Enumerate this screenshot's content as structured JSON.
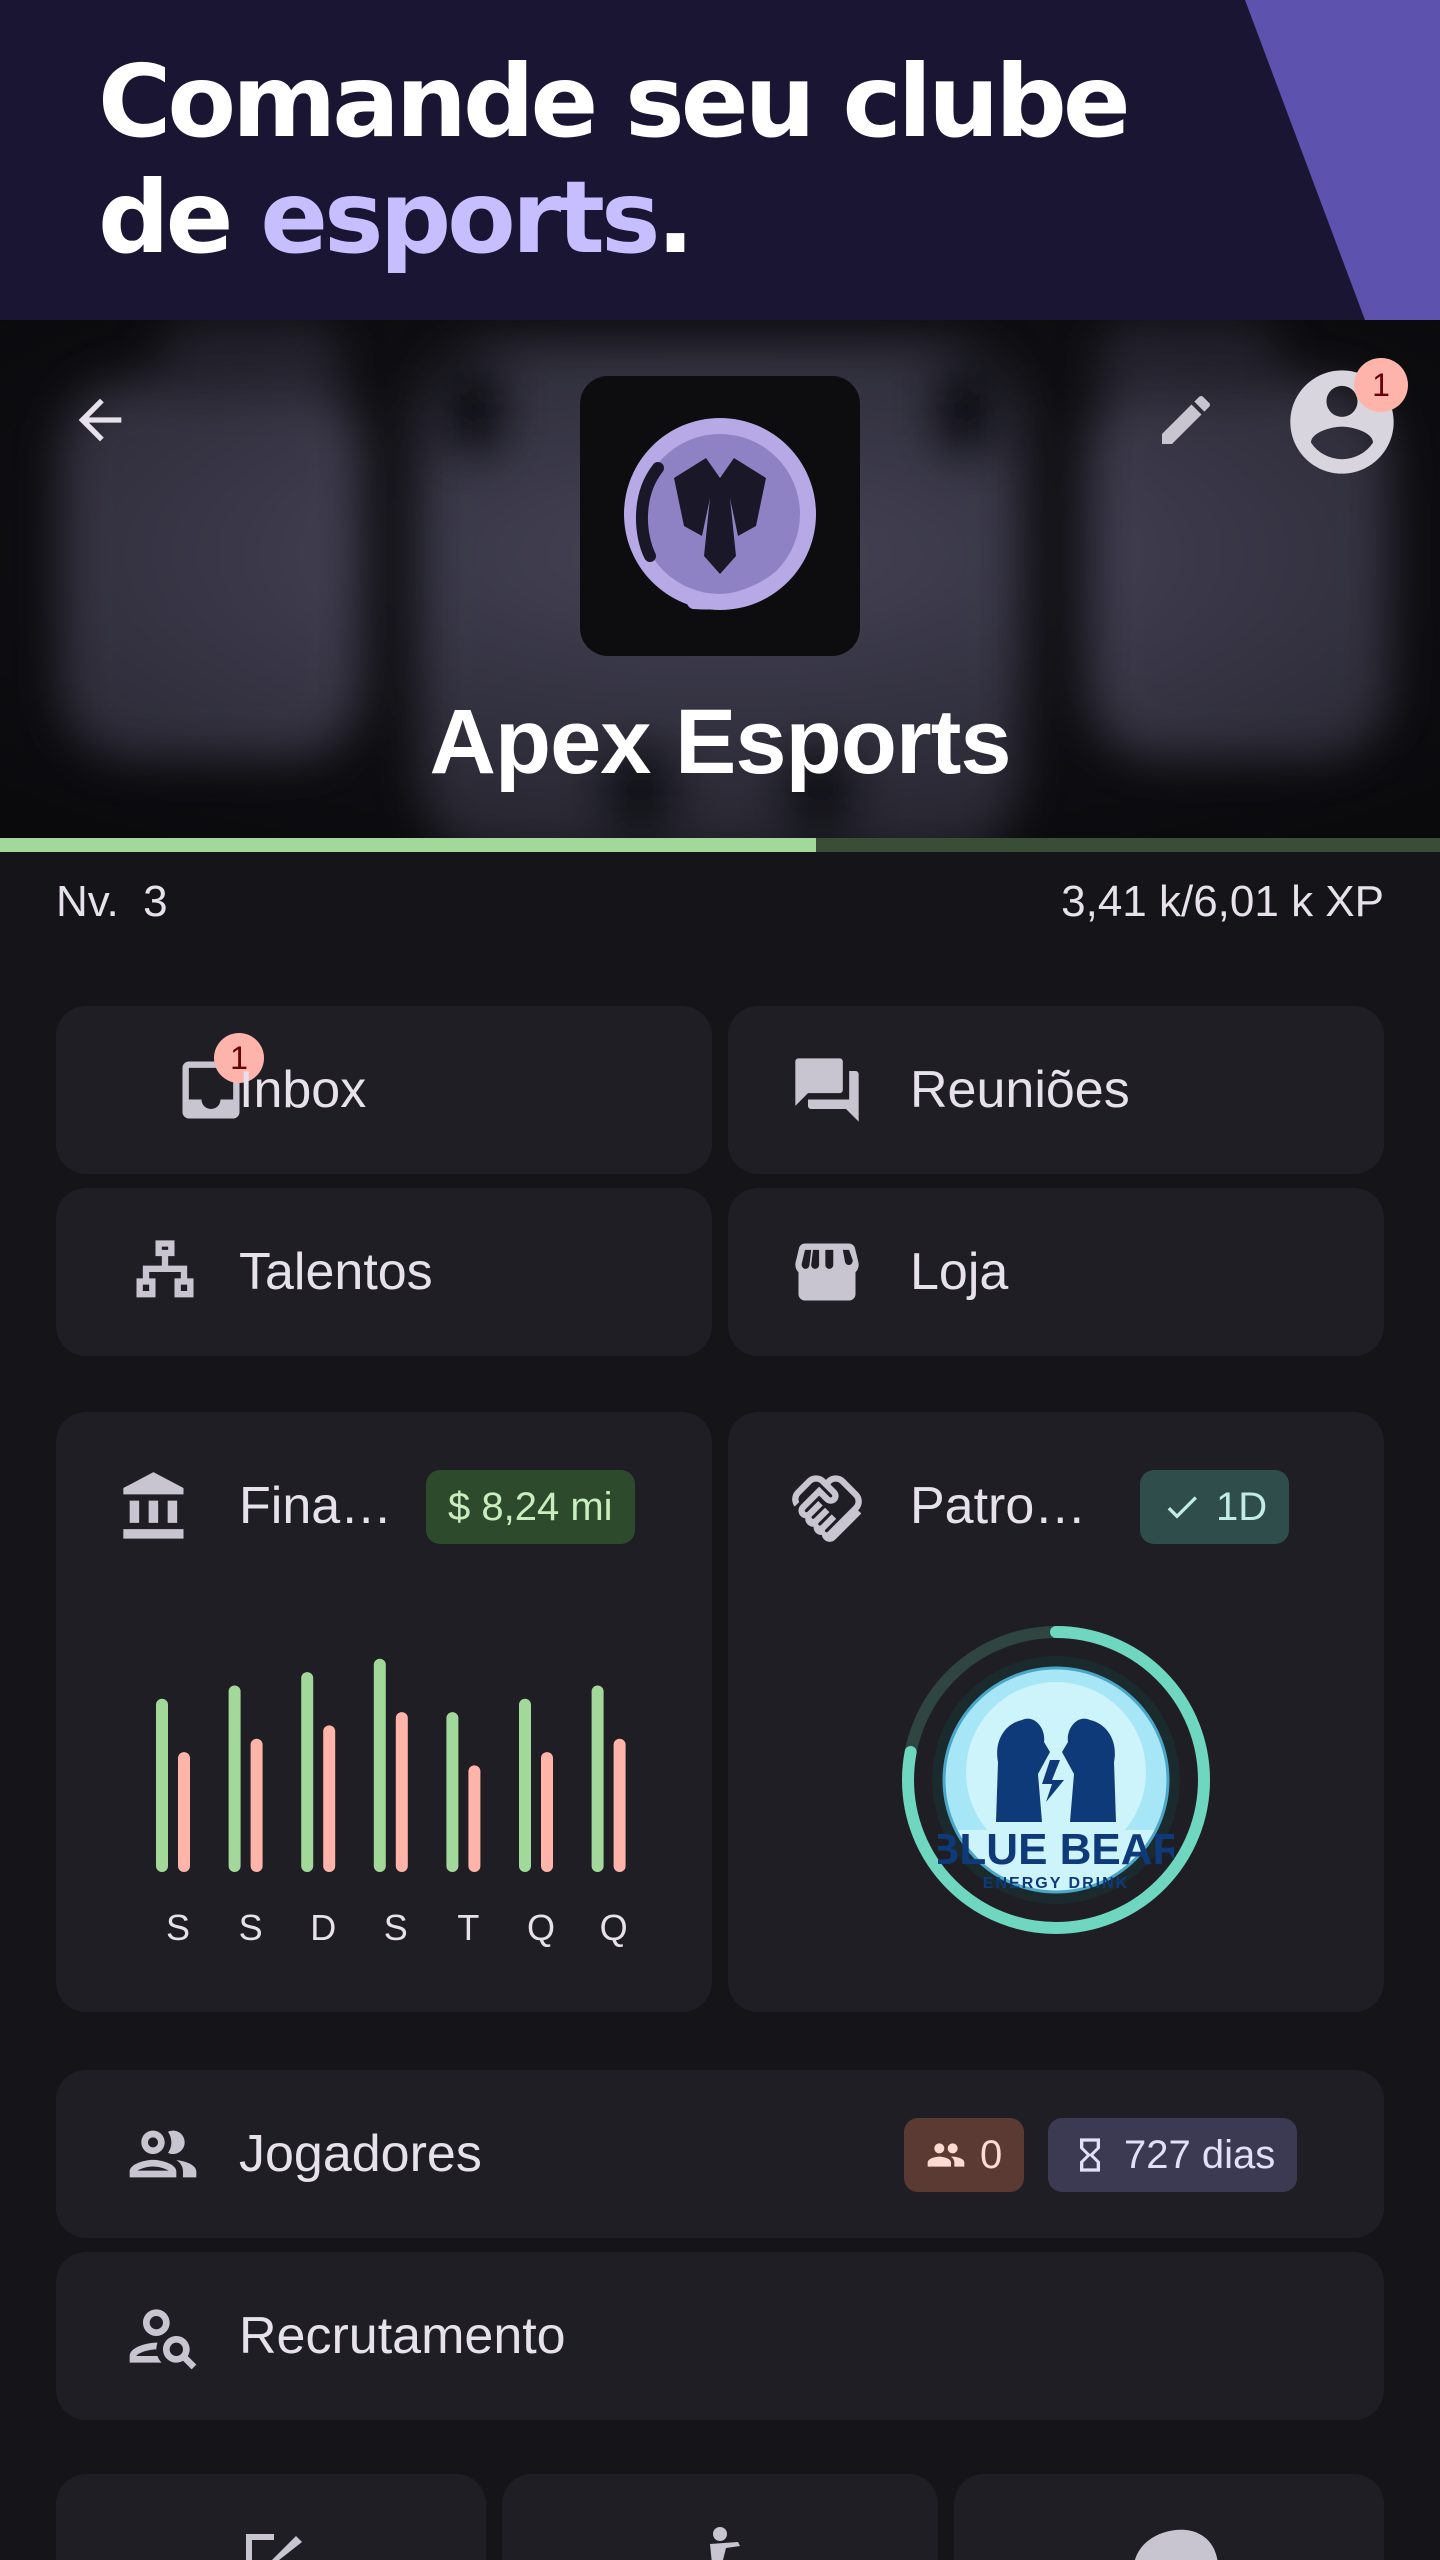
{
  "promo": {
    "line1": "Comande seu clube",
    "line2_prefix": "de ",
    "line2_accent": "esports",
    "line2_suffix": "."
  },
  "header": {
    "club_name": "Apex Esports",
    "profile_badge": "1",
    "icons": {
      "back": "arrow-left-icon",
      "edit": "pencil-icon",
      "profile": "account-circle-icon"
    }
  },
  "level": {
    "label": "Nv.  3",
    "xp_text": "3,41 k/6,01 k XP",
    "progress": 0.567
  },
  "menu": {
    "inbox": {
      "label": "Inbox",
      "badge": "1",
      "icon": "inbox-icon"
    },
    "meetings": {
      "label": "Reuniões",
      "icon": "forum-icon"
    },
    "talents": {
      "label": "Talentos",
      "icon": "org-chart-icon"
    },
    "shop": {
      "label": "Loja",
      "icon": "storefront-icon"
    }
  },
  "finance": {
    "title": "Fina…",
    "chip": "$ 8,24 mi",
    "icon": "bank-icon",
    "colors": {
      "income": "#a2d99a",
      "expense": "#ffb4a9"
    },
    "chart_data": {
      "type": "bar",
      "categories": [
        "S",
        "S",
        "D",
        "S",
        "T",
        "Q",
        "Q"
      ],
      "series": [
        {
          "values": [
            130,
            140,
            150,
            160,
            120,
            130,
            140
          ]
        },
        {
          "values": [
            90,
            100,
            110,
            120,
            80,
            90,
            100
          ]
        }
      ]
    }
  },
  "sponsors": {
    "title": "Patro…",
    "chip": "1D",
    "icon": "handshake-icon",
    "sponsor_logo_text": "BLUE BEAR",
    "sponsor_logo_sub": "ENERGY DRINK",
    "contract_progress": 0.78
  },
  "players": {
    "label": "Jogadores",
    "count": "0",
    "days": "727 dias",
    "icon": "people-icon"
  },
  "recruitment": {
    "label": "Recrutamento",
    "icon": "person-search-icon"
  }
}
